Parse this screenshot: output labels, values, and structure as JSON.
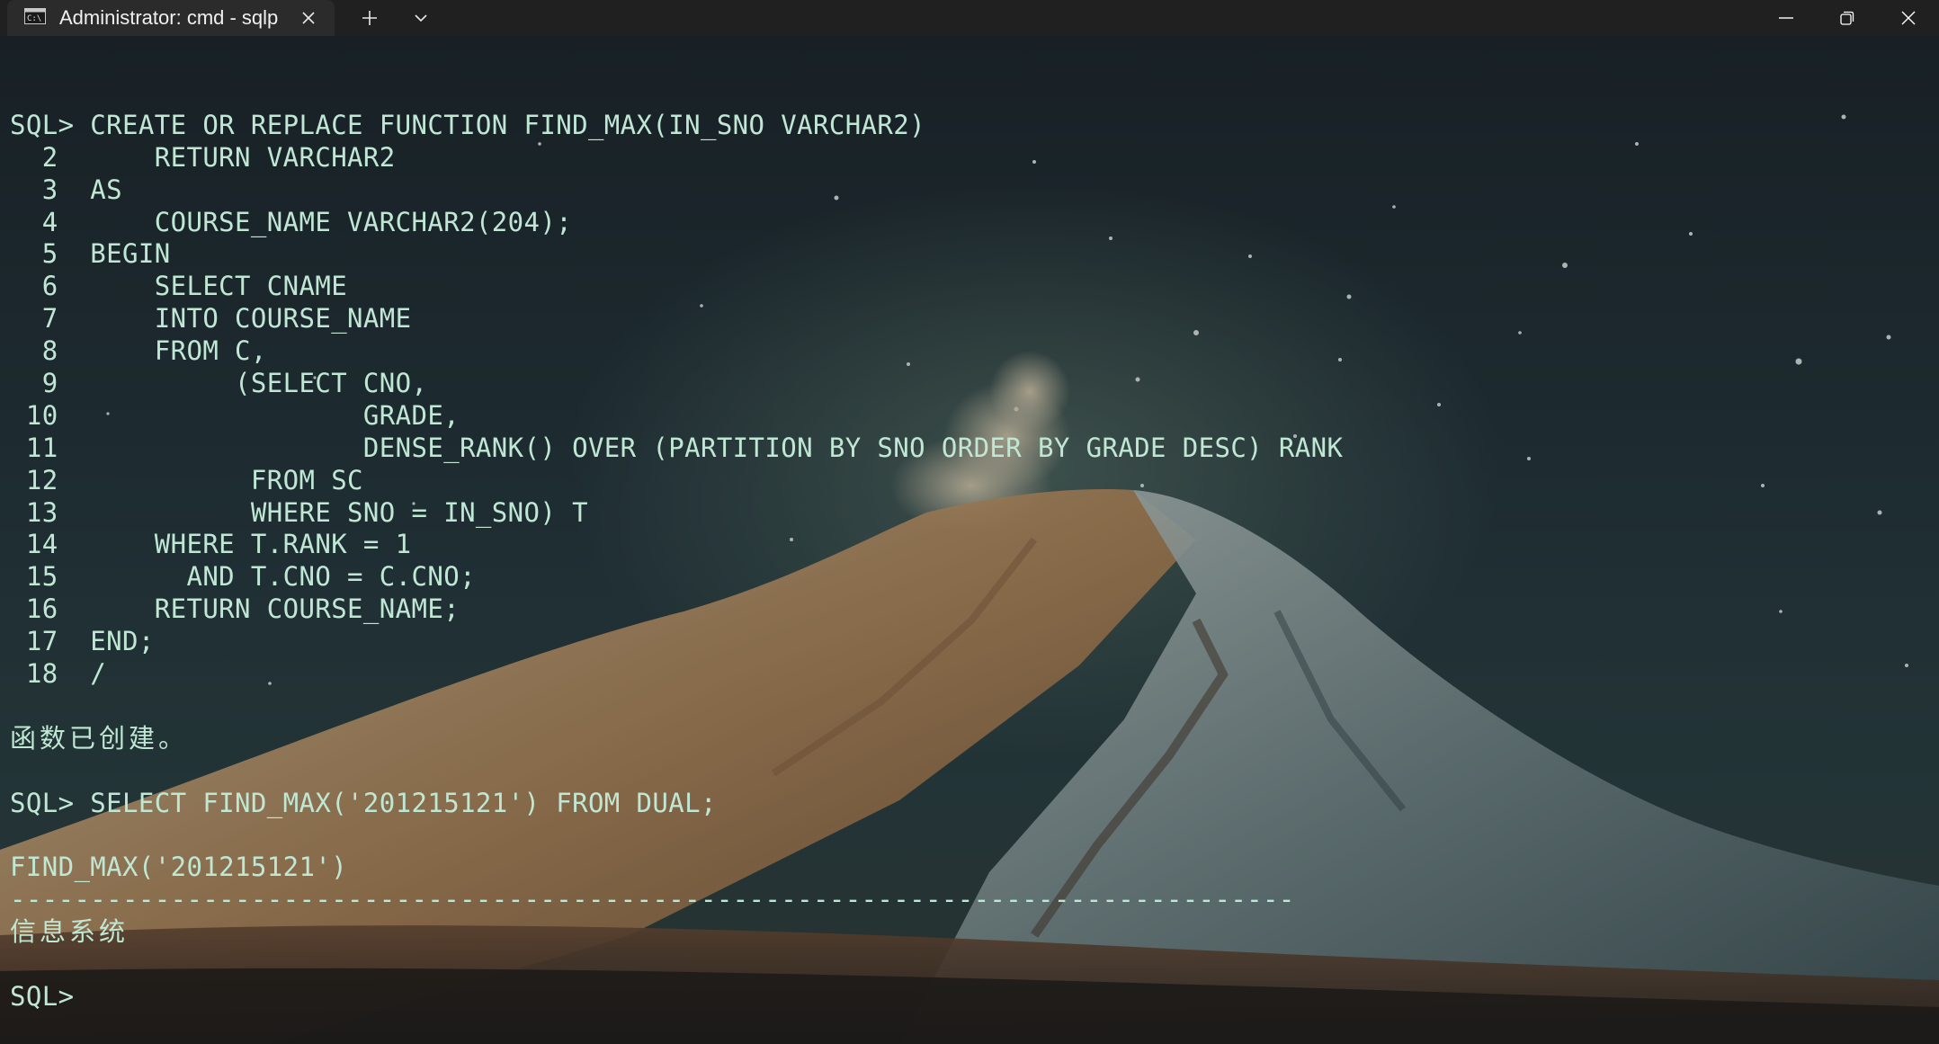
{
  "titlebar": {
    "tab_title": "Administrator: cmd - sqlp",
    "tab_icon": "terminal-icon",
    "new_tab_icon": "plus-icon",
    "dropdown_icon": "chevron-down-icon",
    "minimize_icon": "minimize-icon",
    "restore_icon": "restore-icon",
    "close_icon": "close-icon"
  },
  "colors": {
    "titlebar_bg": "#202020",
    "tab_bg": "#2b2b2b",
    "console_text": "#bfe7d4"
  },
  "console": {
    "lines": [
      "",
      "SQL> CREATE OR REPLACE FUNCTION FIND_MAX(IN_SNO VARCHAR2)",
      "  2      RETURN VARCHAR2",
      "  3  AS",
      "  4      COURSE_NAME VARCHAR2(204);",
      "  5  BEGIN",
      "  6      SELECT CNAME",
      "  7      INTO COURSE_NAME",
      "  8      FROM C,",
      "  9           (SELECT CNO,",
      " 10                   GRADE,",
      " 11                   DENSE_RANK() OVER (PARTITION BY SNO ORDER BY GRADE DESC) RANK",
      " 12            FROM SC",
      " 13            WHERE SNO = IN_SNO) T",
      " 14      WHERE T.RANK = 1",
      " 15        AND T.CNO = C.CNO;",
      " 16      RETURN COURSE_NAME;",
      " 17  END;",
      " 18  /",
      "",
      "函数已创建。",
      "",
      "SQL> SELECT FIND_MAX('201215121') FROM DUAL;",
      "",
      "FIND_MAX('201215121')",
      "--------------------------------------------------------------------------------",
      "信息系统",
      "",
      "SQL>"
    ]
  }
}
